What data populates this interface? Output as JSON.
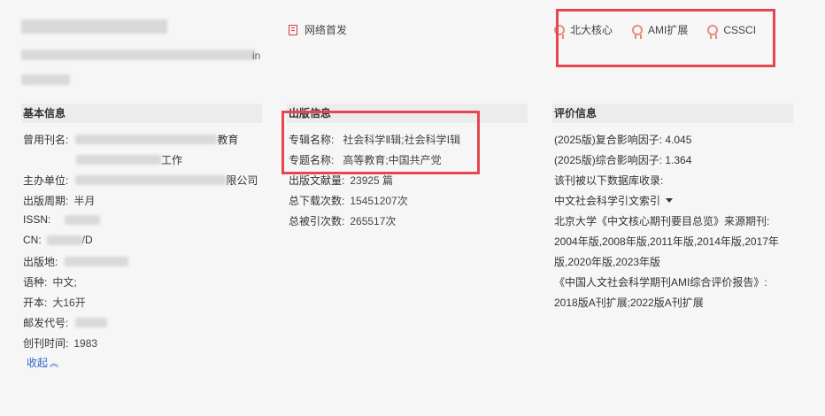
{
  "header": {
    "subtitle_tail": "in"
  },
  "badges": {
    "network_first": "网络首发",
    "certs": [
      "北大核心",
      "AMI扩展",
      "CSSCI"
    ]
  },
  "basic": {
    "title": "基本信息",
    "former_name_label": "曾用刊名:",
    "former_name_tail1": "教育",
    "former_name_tail2": "工作",
    "sponsor_label": "主办单位:",
    "sponsor_tail": "限公司",
    "cycle_label": "出版周期:",
    "cycle_value": "半月",
    "issn_label": "ISSN:",
    "cn_label": "CN:",
    "cn_tail": "/D",
    "place_label": "出版地:",
    "lang_label": "语种:",
    "lang_value": "中文;",
    "format_label": "开本:",
    "format_value": "大16开",
    "postal_label": "邮发代号:",
    "founded_label": "创刊时间:",
    "founded_value": "1983",
    "collapse": "收起"
  },
  "publish": {
    "title": "出版信息",
    "special_series_label": "专辑名称:",
    "special_series_value": "社会科学Ⅱ辑;社会科学Ⅰ辑",
    "special_topic_label": "专题名称:",
    "special_topic_value": "高等教育;中国共产党",
    "docs_label": "出版文献量:",
    "docs_value": "23925 篇",
    "downloads_label": "总下载次数:",
    "downloads_value": "15451207次",
    "cites_label": "总被引次数:",
    "cites_value": "265517次"
  },
  "eval": {
    "title": "评价信息",
    "composite_if": "(2025版)复合影响因子: 4.045",
    "synthetic_if": "(2025版)综合影响因子: 1.364",
    "indexed_by": "该刊被以下数据库收录:",
    "db_select": "中文社会科学引文索引",
    "pku_title": "北京大学《中文核心期刊要目总览》来源期刊:",
    "pku_years1": "2004年版,2008年版,2011年版,2014年版,2017年",
    "pku_years2": "版,2020年版,2023年版",
    "ami_title": "《中国人文社会科学期刊AMI综合评价报告》:",
    "ami_value": "2018版A刊扩展;2022版A刊扩展"
  }
}
